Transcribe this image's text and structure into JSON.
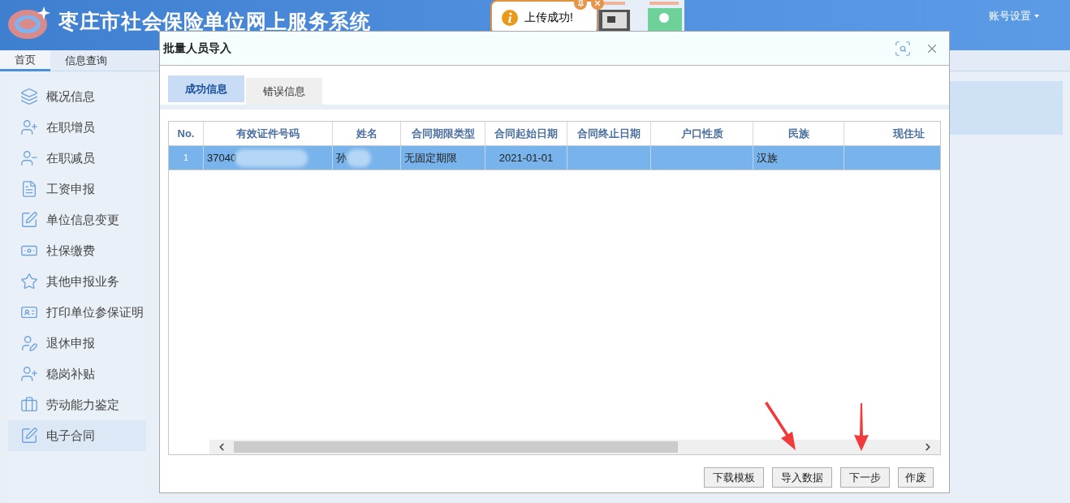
{
  "header": {
    "title": "枣庄市社会保险单位网上服务系统",
    "account": "账号设置"
  },
  "nav_tabs": [
    {
      "label": "首页",
      "selected": true
    },
    {
      "label": "信息查询",
      "selected": false
    }
  ],
  "sidebar": {
    "items": [
      {
        "label": "概况信息",
        "selected": false
      },
      {
        "label": "在职增员",
        "selected": false
      },
      {
        "label": "在职减员",
        "selected": false
      },
      {
        "label": "工资申报",
        "selected": false
      },
      {
        "label": "单位信息变更",
        "selected": false
      },
      {
        "label": "社保缴费",
        "selected": false
      },
      {
        "label": "其他申报业务",
        "selected": false
      },
      {
        "label": "打印单位参保证明",
        "selected": false
      },
      {
        "label": "退休申报",
        "selected": false
      },
      {
        "label": "稳岗补贴",
        "selected": false
      },
      {
        "label": "劳动能力鉴定",
        "selected": false
      },
      {
        "label": "电子合同",
        "selected": true
      }
    ]
  },
  "toast": {
    "message": "上传成功!"
  },
  "dialog": {
    "title": "批量人员导入",
    "tabs": [
      {
        "label": "成功信息",
        "selected": true
      },
      {
        "label": "错误信息",
        "selected": false
      }
    ],
    "table": {
      "columns": [
        "No.",
        "有效证件号码",
        "姓名",
        "合同期限类型",
        "合同起始日期",
        "合同终止日期",
        "户口性质",
        "民族",
        "现住址"
      ],
      "rows": [
        {
          "selected": true,
          "cells": [
            "1",
            "37040",
            "孙",
            "无固定期限",
            "2021-01-01",
            null,
            null,
            "汉族",
            null
          ]
        }
      ]
    },
    "buttons": [
      "下载模板",
      "导入数据",
      "下一步",
      "作废"
    ]
  }
}
